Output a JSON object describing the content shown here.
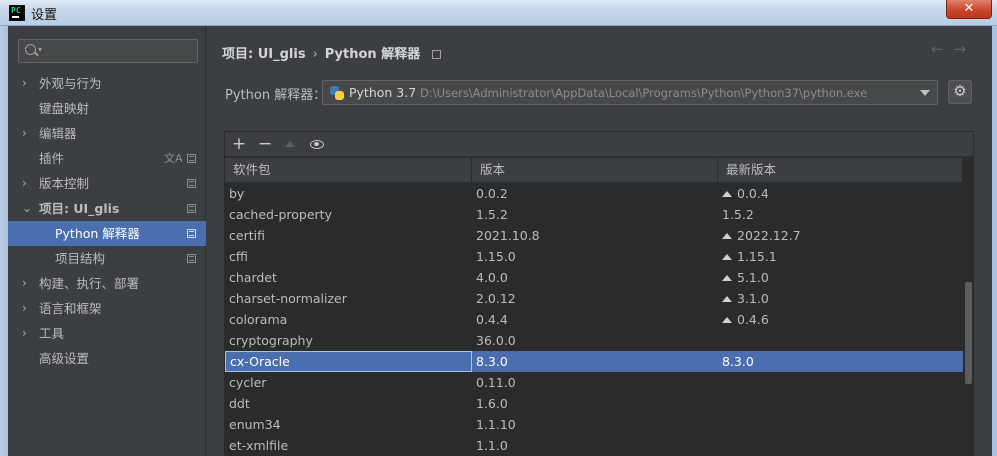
{
  "window": {
    "title": "设置",
    "app_icon_text": "PC",
    "close_glyph": "✕"
  },
  "sidebar": {
    "search_placeholder": "",
    "items": [
      {
        "label": "外观与行为",
        "arrow": "›"
      },
      {
        "label": "键盘映射",
        "arrow": ""
      },
      {
        "label": "编辑器",
        "arrow": "›"
      },
      {
        "label": "插件",
        "arrow": ""
      },
      {
        "label": "版本控制",
        "arrow": "›"
      },
      {
        "label": "项目: UI_glis",
        "arrow": "⌄"
      },
      {
        "label": "Python 解释器",
        "arrow": ""
      },
      {
        "label": "项目结构",
        "arrow": ""
      },
      {
        "label": "构建、执行、部署",
        "arrow": "›"
      },
      {
        "label": "语言和框架",
        "arrow": "›"
      },
      {
        "label": "工具",
        "arrow": "›"
      },
      {
        "label": "高级设置",
        "arrow": ""
      }
    ],
    "selected": "Python 解释器",
    "translate_glyph": "文A"
  },
  "header": {
    "breadcrumb_project": "项目: UI_glis",
    "breadcrumb_sep": "›",
    "breadcrumb_page": "Python 解释器",
    "back_glyph": "←",
    "forward_glyph": "→"
  },
  "interpreter": {
    "label": "Python 解释器：",
    "name": "Python 3.7",
    "path": "D:\\Users\\Administrator\\AppData\\Local\\Programs\\Python\\Python37\\python.exe",
    "gear_glyph": "⚙"
  },
  "toolbar": {
    "add_glyph": "+",
    "remove_glyph": "−"
  },
  "table": {
    "columns": [
      "软件包",
      "版本",
      "最新版本"
    ],
    "rows": [
      {
        "name": "by",
        "version": "0.0.2",
        "latest": "0.0.4",
        "upgrade": true
      },
      {
        "name": "cached-property",
        "version": "1.5.2",
        "latest": "1.5.2",
        "upgrade": false
      },
      {
        "name": "certifi",
        "version": "2021.10.8",
        "latest": "2022.12.7",
        "upgrade": true
      },
      {
        "name": "cffi",
        "version": "1.15.0",
        "latest": "1.15.1",
        "upgrade": true
      },
      {
        "name": "chardet",
        "version": "4.0.0",
        "latest": "5.1.0",
        "upgrade": true
      },
      {
        "name": "charset-normalizer",
        "version": "2.0.12",
        "latest": "3.1.0",
        "upgrade": true
      },
      {
        "name": "colorama",
        "version": "0.4.4",
        "latest": "0.4.6",
        "upgrade": true
      },
      {
        "name": "cryptography",
        "version": "36.0.0",
        "latest": "",
        "upgrade": false
      },
      {
        "name": "cx-Oracle",
        "version": "8.3.0",
        "latest": "8.3.0",
        "upgrade": false,
        "selected": true
      },
      {
        "name": "cycler",
        "version": "0.11.0",
        "latest": "",
        "upgrade": false
      },
      {
        "name": "ddt",
        "version": "1.6.0",
        "latest": "",
        "upgrade": false
      },
      {
        "name": "enum34",
        "version": "1.1.10",
        "latest": "",
        "upgrade": false
      },
      {
        "name": "et-xmlfile",
        "version": "1.1.0",
        "latest": "",
        "upgrade": false
      }
    ]
  }
}
